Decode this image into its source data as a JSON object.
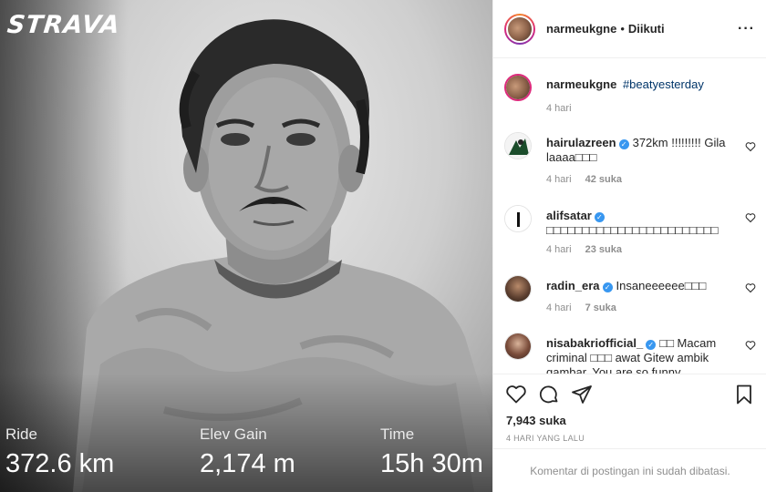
{
  "photo": {
    "logo": "STRAVA",
    "stats": [
      {
        "label": "Ride",
        "value": "372.6 km"
      },
      {
        "label": "Elev Gain",
        "value": "2,174 m"
      },
      {
        "label": "Time",
        "value": "15h 30m"
      }
    ]
  },
  "header": {
    "username": "narmeukgne",
    "separator": "•",
    "follow_status": "Diikuti",
    "more_icon": "ellipsis-icon"
  },
  "caption": {
    "username": "narmeukgne",
    "text": "#beatyesterday",
    "time": "4 hari"
  },
  "comments": [
    {
      "username": "hairulazreen",
      "verified": true,
      "text": "372km !!!!!!!!! Gila laaaa□□□",
      "time": "4 hari",
      "likes": "42 suka"
    },
    {
      "username": "alifsatar",
      "verified": true,
      "text": "□□□□□□□□□□□□□□□□□□□□□□□□",
      "time": "4 hari",
      "likes": "23 suka"
    },
    {
      "username": "radin_era",
      "verified": true,
      "text": "Insaneeeeee□□□",
      "time": "4 hari",
      "likes": "7 suka"
    },
    {
      "username": "nisabakriofficial_",
      "verified": true,
      "text": "□□ Macam criminal □□□ awat Gitew ambik gambar. You are so funny",
      "time": "",
      "likes": ""
    }
  ],
  "actions": {
    "likes_count": "7,943 suka",
    "time_ago": "4 HARI YANG LALU",
    "comments_disabled": "Komentar di postingan ini sudah dibatasi."
  },
  "colors": {
    "link": "#003569",
    "verified": "#3897f0",
    "muted": "#8e8e8e",
    "text": "#262626"
  }
}
